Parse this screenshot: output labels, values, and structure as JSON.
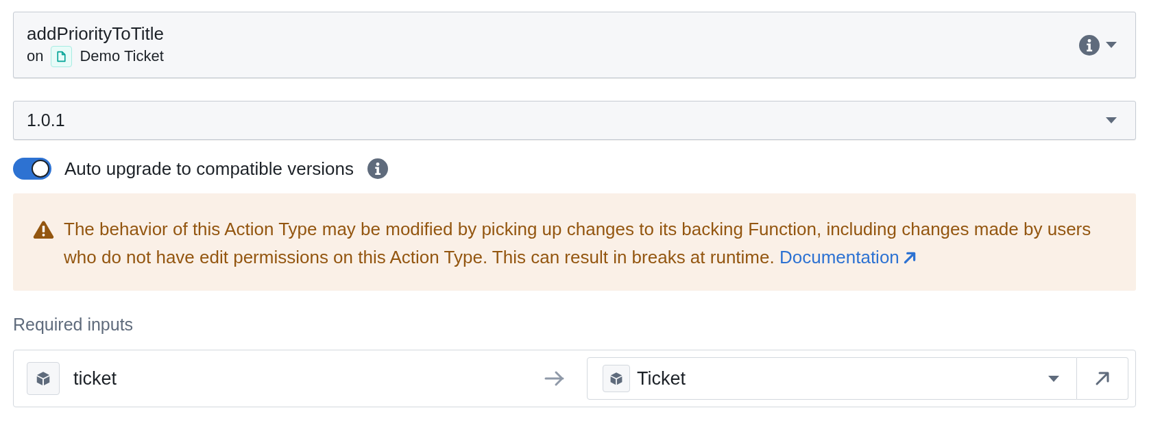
{
  "action": {
    "name": "addPriorityToTitle",
    "on_label": "on",
    "object_type": "Demo Ticket"
  },
  "version_select": {
    "value": "1.0.1"
  },
  "auto_upgrade": {
    "label": "Auto upgrade to compatible versions",
    "on": true
  },
  "warning": {
    "text": "The behavior of this Action Type may be modified by picking up changes to its backing Function, including changes made by users who do not have edit permissions on this Action Type. This can result in breaks at runtime.",
    "link": "Documentation"
  },
  "required_inputs": {
    "title": "Required inputs",
    "rows": [
      {
        "parameter": "ticket",
        "object_type": "Ticket"
      }
    ]
  }
}
